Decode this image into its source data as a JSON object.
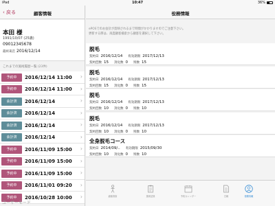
{
  "status_bar": {
    "device": "iPad",
    "time": "10:47",
    "battery": "36%"
  },
  "left": {
    "back_label": "戻る",
    "title": "顧客情報",
    "customer": {
      "name": "本田 様",
      "dob": "1991/10/07 (25歳)",
      "phone": "09012345678",
      "last_visit_label": "最終来店",
      "last_visit_date": "2016/12/14"
    },
    "history_header": "これまでの施術履歴一覧 (23件)",
    "history": [
      {
        "status": "予約中",
        "kind": "reserved",
        "date": "2016/12/14 11:00"
      },
      {
        "status": "予約中",
        "kind": "reserved",
        "date": "2016/12/14 11:00"
      },
      {
        "status": "会計済",
        "kind": "paid",
        "date": "2016/12/14"
      },
      {
        "status": "会計済",
        "kind": "paid",
        "date": "2016/12/14"
      },
      {
        "status": "会計済",
        "kind": "paid",
        "date": "2016/12/14"
      },
      {
        "status": "会計済",
        "kind": "paid",
        "date": "2016/12/14"
      },
      {
        "status": "予約中",
        "kind": "reserved",
        "date": "2016/11/09 15:00"
      },
      {
        "status": "予約中",
        "kind": "reserved",
        "date": "2016/11/09 15:00"
      },
      {
        "status": "予約中",
        "kind": "reserved",
        "date": "2016/11/09 15:00"
      },
      {
        "status": "予約中",
        "kind": "reserved",
        "date": "2016/11/01 09:20"
      },
      {
        "status": "予約中",
        "kind": "reserved",
        "date": "2016/10/28 10:00"
      }
    ],
    "mode_label": "ユーザーモード"
  },
  "right": {
    "title": "役務情報",
    "notice_line1": "ePOSでのお会計が反映されるまで時間がかかりますのでご注意下さい。",
    "notice_line2": "更新する際は、再度顧客検索から顧客を選択して下さい。",
    "labels": {
      "contract_date": "契約日",
      "expiry": "有効期限",
      "contract_count": "契約回数",
      "used_count": "消化数",
      "remaining": "残数"
    },
    "contracts": [
      {
        "name": "脱毛",
        "contract_date": "2016/12/14",
        "expiry": "2017/12/13",
        "contract_count": "15",
        "used_count": "0",
        "remaining": "15"
      },
      {
        "name": "脱毛",
        "contract_date": "2016/12/14",
        "expiry": "2017/12/13",
        "contract_count": "15",
        "used_count": "0",
        "remaining": "15"
      },
      {
        "name": "脱毛",
        "contract_date": "2016/12/14",
        "expiry": "2017/12/13",
        "contract_count": "10",
        "used_count": "0",
        "remaining": "10"
      },
      {
        "name": "脱毛",
        "contract_date": "2016/12/14",
        "expiry": "2017/12/13",
        "contract_count": "10",
        "used_count": "0",
        "remaining": "10"
      },
      {
        "name": "全身脱毛コース",
        "contract_date": "2014/09/..",
        "expiry": "2015/09/30",
        "contract_count": "10",
        "used_count": "0",
        "remaining": "10"
      }
    ],
    "tabs": [
      {
        "label": "顧客検索",
        "icon": "person-icon"
      },
      {
        "label": "施術記録",
        "icon": "clipboard-icon"
      },
      {
        "label": "予約カレンダー",
        "icon": "calendar-icon"
      },
      {
        "label": "日報",
        "icon": "document-icon"
      },
      {
        "label": "役務情報",
        "icon": "profile-icon",
        "active": true
      }
    ]
  },
  "colors": {
    "accent": "#b0335a",
    "reserved_badge": "#b0557a",
    "paid_badge": "#5e8d99",
    "active_tab": "#3a8fd6"
  }
}
